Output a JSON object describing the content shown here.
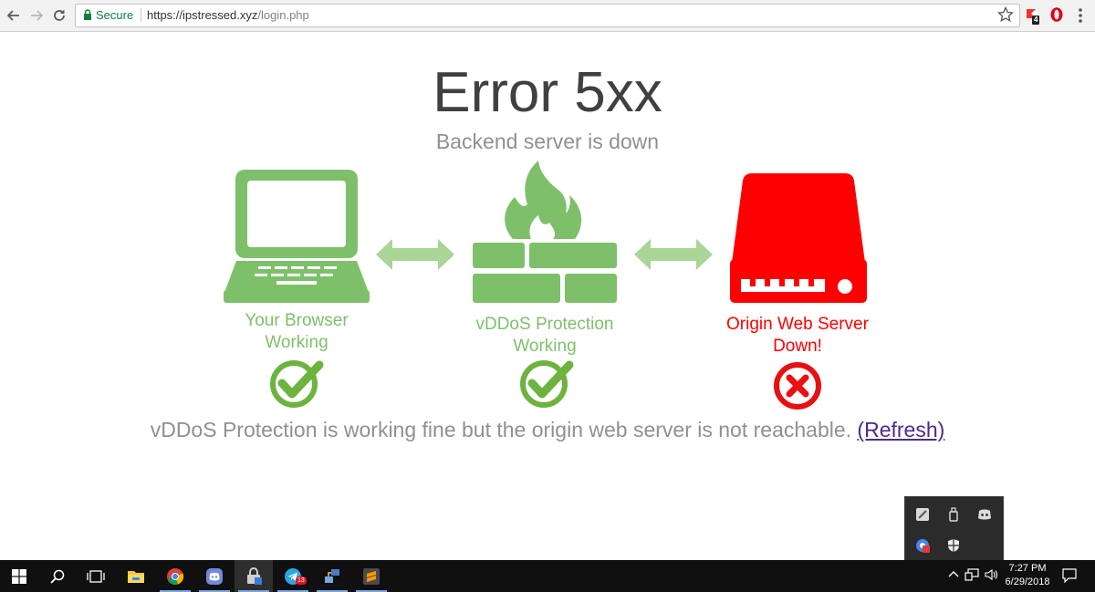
{
  "browser": {
    "secure_label": "Secure",
    "url_host": "https://ipstressed.xyz",
    "url_path": "/login.php",
    "extension_badge": "4"
  },
  "page": {
    "title": "Error 5xx",
    "subtitle": "Backend server is down",
    "nodes": [
      {
        "line1": "Your Browser",
        "line2": "Working",
        "status": "ok"
      },
      {
        "line1": "vDDoS Protection",
        "line2": "Working",
        "status": "ok"
      },
      {
        "line1": "Origin Web Server",
        "line2": "Down!",
        "status": "error"
      }
    ],
    "message": "vDDoS Protection is working fine but the origin web server is not reachable.",
    "refresh_label": "(Refresh)"
  },
  "colors": {
    "ok_green": "#7ec06a",
    "check_green": "#6cb33f",
    "error_red": "#ff0000",
    "text_gray": "#909090",
    "title_dark": "#404040"
  },
  "taskbar": {
    "telegram_badge": "13",
    "time": "7:27 PM",
    "date": "6/29/2018"
  }
}
